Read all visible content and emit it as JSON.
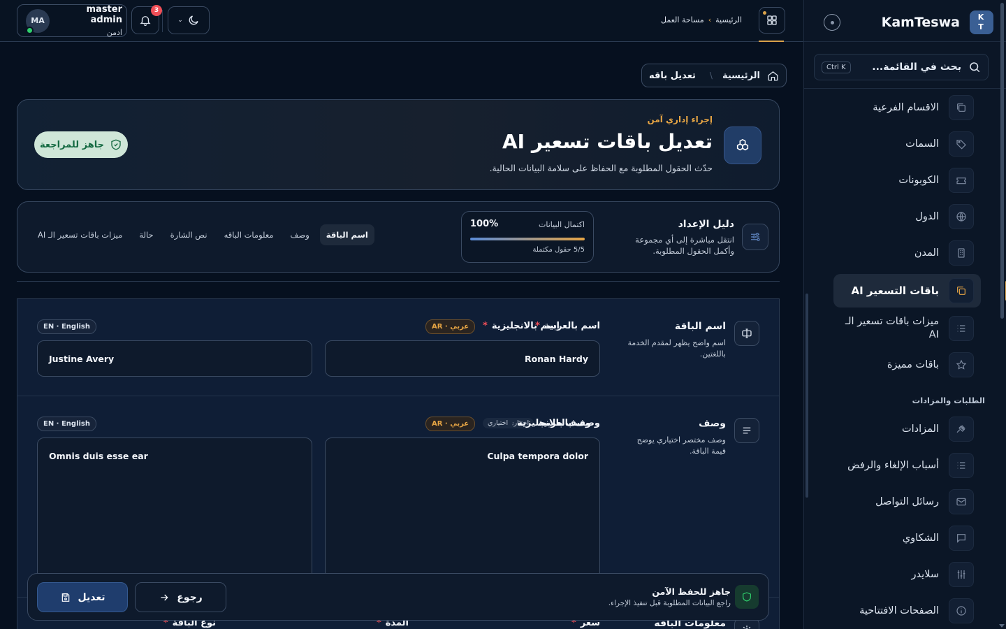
{
  "brand": {
    "badge_top": "K",
    "badge_bottom": "T",
    "name": "KamTeswa"
  },
  "sidebar": {
    "search_placeholder": "بحث في القائمة...",
    "search_shortcut": "Ctrl K",
    "items": [
      {
        "label": "الاقسام الفرعية",
        "icon": "layers-icon"
      },
      {
        "label": "السمات",
        "icon": "tag-icon"
      },
      {
        "label": "الكوبونات",
        "icon": "ticket-icon"
      },
      {
        "label": "الدول",
        "icon": "globe-icon"
      },
      {
        "label": "المدن",
        "icon": "building-icon"
      },
      {
        "label": "باقات التسعير AI",
        "icon": "copy-icon",
        "active": true
      },
      {
        "label": "ميزات باقات تسعير الـ AI",
        "icon": "list-icon"
      },
      {
        "label": "باقات مميزة",
        "icon": "star-icon"
      }
    ],
    "section_label": "الطلبات والمزادات",
    "items2": [
      {
        "label": "المزادات",
        "icon": "gavel-icon"
      },
      {
        "label": "أسباب الإلغاء والرفض",
        "icon": "list-icon"
      },
      {
        "label": "رسائل التواصل",
        "icon": "mail-icon"
      },
      {
        "label": "الشكاوي",
        "icon": "message-icon"
      },
      {
        "label": "سلايدر",
        "icon": "sliders-icon"
      },
      {
        "label": "الصفحات الافتتاحية",
        "icon": "info-icon"
      }
    ]
  },
  "topbar": {
    "user_initials": "MA",
    "user_name": "master admin",
    "user_role": "ادمن",
    "notifications_count": "3",
    "crumb_home": "الرئيسية",
    "crumb_workspace": "مساحة العمل",
    "crumb_sep": "›"
  },
  "breadcrumb": {
    "home": "الرئيسية",
    "current": "تعديل باقه",
    "sep": "\\"
  },
  "hero": {
    "tag": "إجراء إداري آمن",
    "title": "تعديل باقات تسعير AI",
    "subtitle": "حدّث الحقول المطلوبة مع الحفاظ على سلامة البيانات الحالية.",
    "status": "جاهز للمراجعة"
  },
  "guide": {
    "title": "دليل الإعداد",
    "subtitle": "انتقل مباشرة إلى أي مجموعة وأكمل الحقول المطلوبة.",
    "progress_label": "اكتمال البيانات",
    "progress_pct": "100%",
    "progress_value": 100,
    "progress_count": "5/5 حقول مكتملة",
    "tabs": [
      "اسم الباقة",
      "وصف",
      "معلومات الباقه",
      "نص الشارة",
      "حالة",
      "ميزات باقات تسعير الـ AI"
    ]
  },
  "form": {
    "name_section": {
      "title": "اسم الباقة",
      "subtitle": "اسم واضح يظهر لمقدم الخدمة باللغتين.",
      "ar_label": "اسم بالعربية",
      "en_label": "اسم بالانجليزية",
      "ar_badge": "AR · عربي",
      "en_badge": "EN · English",
      "ar_value": "Ronan Hardy",
      "en_value": "Justine Avery"
    },
    "desc_section": {
      "title": "وصف",
      "subtitle": "وصف مختصر اختياري يوضح قيمة الباقة.",
      "ar_label": "وصف بالعربية",
      "en_label": "وصف بالانجليزية",
      "optional": "اختياري",
      "ar_badge": "AR · عربي",
      "en_badge": "EN · English",
      "ar_value": "Culpa tempora dolor",
      "en_value": "Omnis duis esse ear"
    },
    "info_section": {
      "title": "معلومات الباقه",
      "price_label": "سعر",
      "duration_label": "المدة",
      "type_label": "نوع الباقة"
    },
    "required_mark": "*"
  },
  "savebar": {
    "title": "جاهز للحفظ الآمن",
    "subtitle": "راجع البيانات المطلوبة قبل تنفيذ الإجراء.",
    "save_label": "تعديل",
    "back_label": "رجوع"
  }
}
